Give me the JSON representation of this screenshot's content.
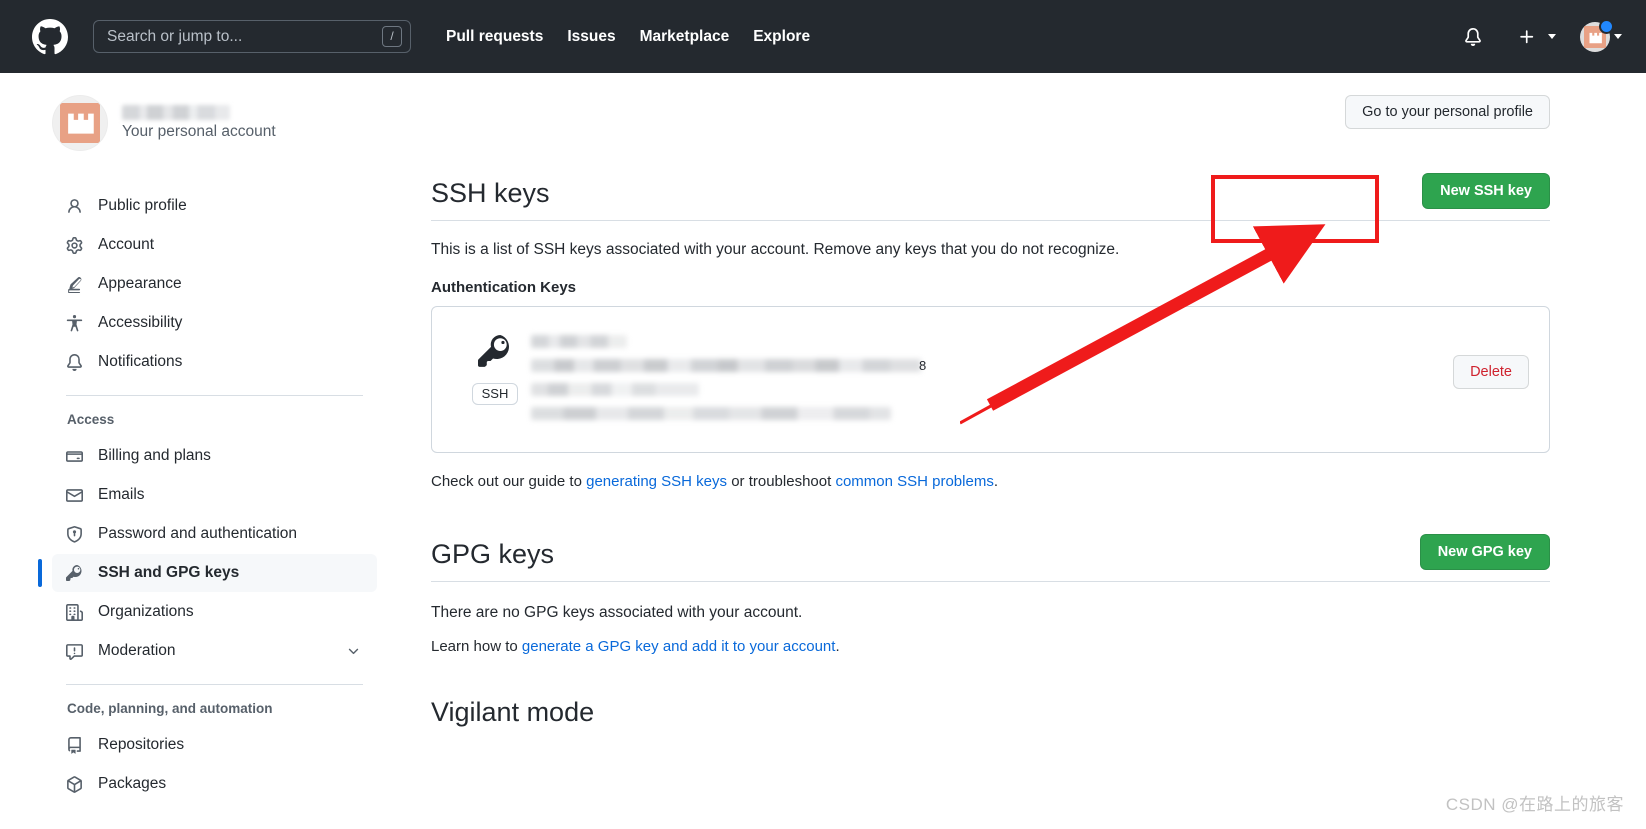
{
  "header": {
    "logo_icon": "github-mark-icon",
    "search": {
      "placeholder": "Search or jump to...",
      "value": "",
      "shortcut_badge": "/"
    },
    "nav": [
      {
        "label": "Pull requests"
      },
      {
        "label": "Issues"
      },
      {
        "label": "Marketplace"
      },
      {
        "label": "Explore"
      }
    ],
    "notifications_icon": "bell-icon",
    "create_new_icon": "plus-icon",
    "create_new_caret_icon": "chevron-down-icon",
    "avatar_icon": "user-avatar",
    "avatar_caret_icon": "chevron-down-icon",
    "status_dot_color": "#2188ff",
    "background_color": "#24292f"
  },
  "sidebar": {
    "account": {
      "name_redacted": "",
      "subtitle": "Your personal account",
      "avatar_icon": "user-avatar"
    },
    "primary_items": [
      {
        "label": "Public profile",
        "icon": "person-icon",
        "selected": false
      },
      {
        "label": "Account",
        "icon": "gear-icon",
        "selected": false
      },
      {
        "label": "Appearance",
        "icon": "paintbrush-icon",
        "selected": false
      },
      {
        "label": "Accessibility",
        "icon": "accessibility-icon",
        "selected": false
      },
      {
        "label": "Notifications",
        "icon": "bell-icon",
        "selected": false
      }
    ],
    "access_group_title": "Access",
    "access_items": [
      {
        "label": "Billing and plans",
        "icon": "credit-card-icon",
        "selected": false
      },
      {
        "label": "Emails",
        "icon": "mail-icon",
        "selected": false
      },
      {
        "label": "Password and authentication",
        "icon": "shield-lock-icon",
        "selected": false
      },
      {
        "label": "SSH and GPG keys",
        "icon": "key-icon",
        "selected": true
      },
      {
        "label": "Organizations",
        "icon": "organization-icon",
        "selected": false
      },
      {
        "label": "Moderation",
        "icon": "report-icon",
        "selected": false,
        "chevron": "chevron-down-icon"
      }
    ],
    "code_group_title": "Code, planning, and automation",
    "code_items": [
      {
        "label": "Repositories",
        "icon": "repo-icon",
        "selected": false
      },
      {
        "label": "Packages",
        "icon": "package-icon",
        "selected": false
      }
    ],
    "selected_accent_color": "#0969da"
  },
  "main": {
    "personal_profile_button": "Go to your personal profile",
    "ssh": {
      "title": "SSH keys",
      "new_key_button": "New SSH key",
      "description": "This is a list of SSH keys associated with your account. Remove any keys that you do not recognize.",
      "subheading": "Authentication Keys",
      "key_card": {
        "icon": "key-icon",
        "badge": "SSH",
        "title_redacted": "",
        "fingerprint_redacted": "",
        "fingerprint_tail": "8",
        "added_redacted": "",
        "last_used_redacted": "",
        "delete_button": "Delete"
      },
      "help_prefix": "Check out our guide to ",
      "help_link_1": "generating SSH keys",
      "help_middle": " or troubleshoot ",
      "help_link_2": "common SSH problems",
      "help_suffix": "."
    },
    "gpg": {
      "title": "GPG keys",
      "new_key_button": "New GPG key",
      "empty_text": "There are no GPG keys associated with your account.",
      "learn_prefix": "Learn how to ",
      "learn_link": "generate a GPG key and add it to your account",
      "learn_suffix": "."
    },
    "vigilant": {
      "title": "Vigilant mode"
    }
  },
  "annotations": {
    "highlight_box_color": "#ef1b1b",
    "arrow_color": "#ef1b1b",
    "target": "New SSH key"
  },
  "watermark": {
    "text": "CSDN @在路上的旅客"
  },
  "theme": {
    "green_button": "#2ea44f",
    "link_blue": "#0969da",
    "danger_red": "#cf222e",
    "header_bg": "#24292f"
  }
}
